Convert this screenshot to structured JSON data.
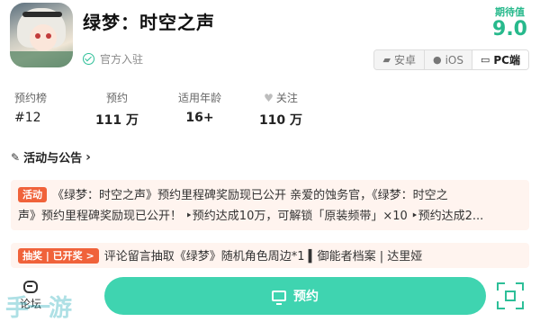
{
  "app": {
    "title": "绿梦：时空之声",
    "official_label": "官方入驻",
    "expect_label": "期待值",
    "expect_value": "9.0"
  },
  "platforms": [
    {
      "label": "安卓",
      "icon": "android-icon"
    },
    {
      "label": "iOS",
      "icon": "apple-icon"
    },
    {
      "label": "PC端",
      "icon": "monitor-icon"
    }
  ],
  "stats": [
    {
      "label": "预约榜",
      "value": "#12"
    },
    {
      "label": "预约",
      "value": "111 万"
    },
    {
      "label": "适用年龄",
      "value": "16+"
    },
    {
      "label": "关注",
      "value": "110 万",
      "icon": "heart-icon"
    }
  ],
  "activity": {
    "section_title": "活动与公告",
    "card1": {
      "tag": "活动",
      "line1": "《绿梦：时空之声》预约里程碑奖励现已公开 亲爱的蚀务官，《绿梦：时空之",
      "line2": "声》预约里程碑奖励现已公开！  ‣预约达成10万，可解锁「原装频带」×10 ‣预约达成2..."
    },
    "card2": {
      "tag": "抽奖 | 已开奖 >",
      "text": "评论留言抽取《绿梦》随机角色周边*1 ▍御能者档案 | 达里娅"
    }
  },
  "bottom": {
    "comment_label": "论坛",
    "reserve_label": "预约",
    "watermark": "手一游"
  }
}
